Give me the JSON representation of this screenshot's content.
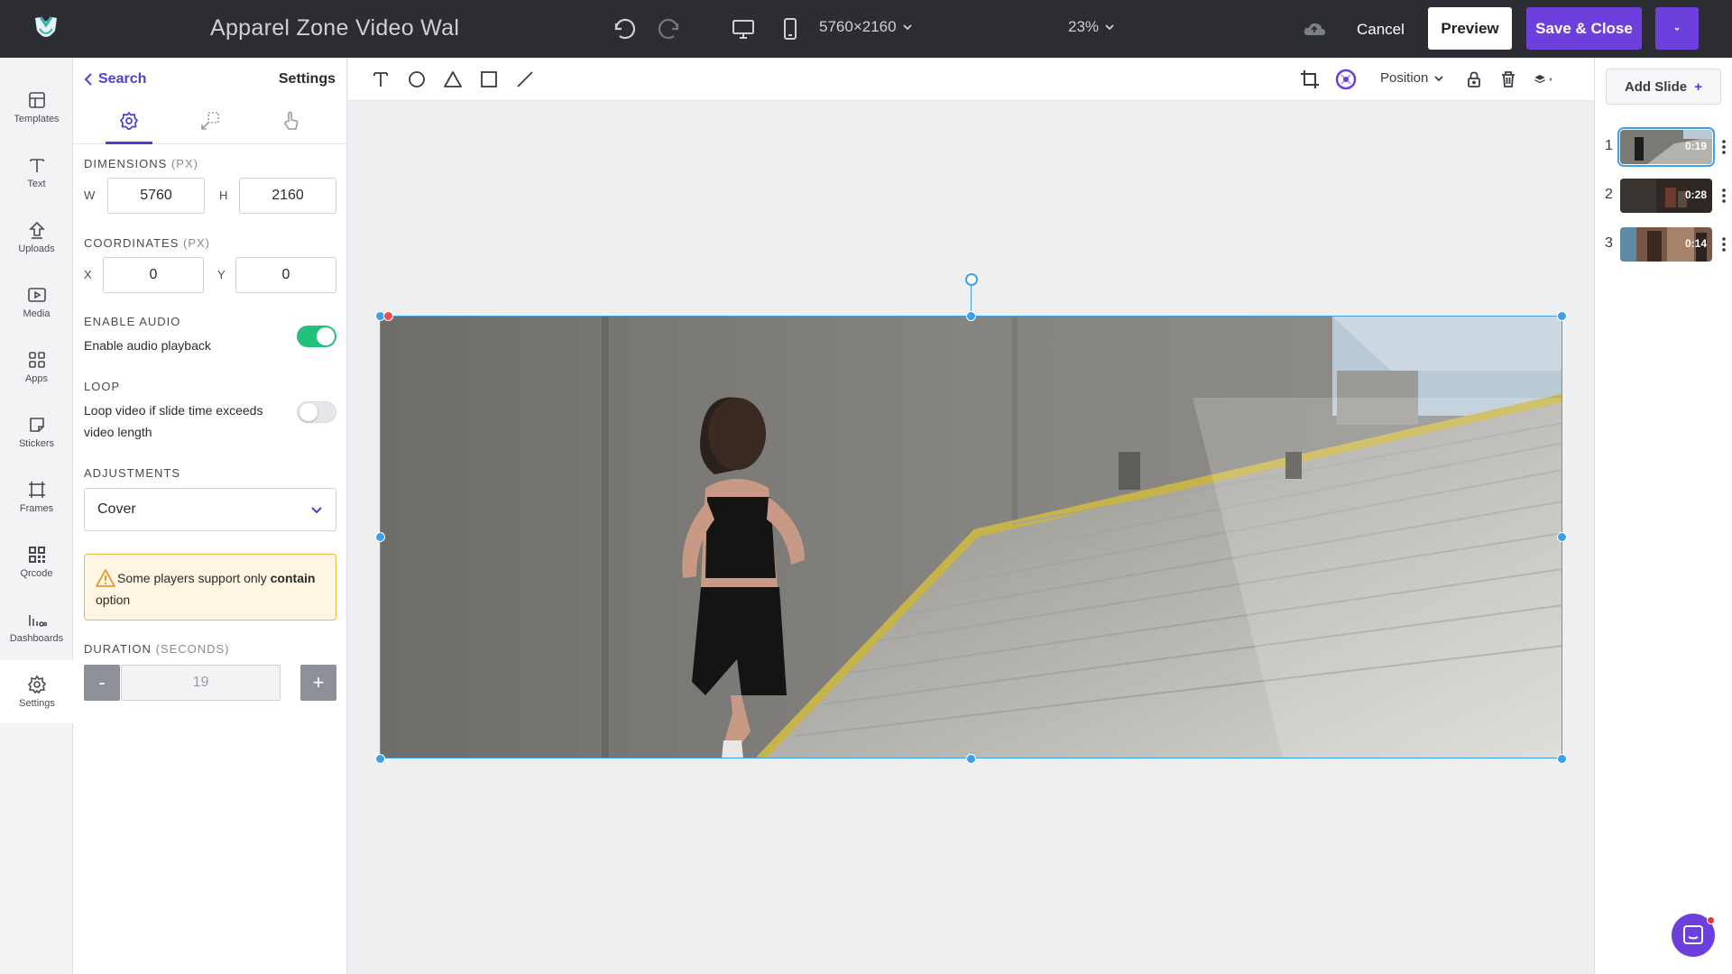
{
  "header": {
    "title": "Apparel Zone Video Wal",
    "resolution": "5760×2160",
    "zoom": "23%",
    "cancel_label": "Cancel",
    "preview_label": "Preview",
    "save_close_label": "Save & Close"
  },
  "nav": {
    "items": [
      {
        "label": "Templates",
        "icon": "templates-icon"
      },
      {
        "label": "Text",
        "icon": "text-icon"
      },
      {
        "label": "Uploads",
        "icon": "uploads-icon"
      },
      {
        "label": "Media",
        "icon": "media-icon"
      },
      {
        "label": "Apps",
        "icon": "apps-icon"
      },
      {
        "label": "Stickers",
        "icon": "stickers-icon"
      },
      {
        "label": "Frames",
        "icon": "frames-icon"
      },
      {
        "label": "Qrcode",
        "icon": "qrcode-icon"
      },
      {
        "label": "Dashboards",
        "icon": "dashboards-icon"
      },
      {
        "label": "Settings",
        "icon": "settings-icon"
      }
    ],
    "active": "Settings"
  },
  "settings": {
    "back_label": "Search",
    "title": "Settings",
    "dimensions": {
      "label": "Dimensions",
      "unit": "(PX)",
      "w_label": "W",
      "w": "5760",
      "h_label": "H",
      "h": "2160"
    },
    "coordinates": {
      "label": "Coordinates",
      "unit": "(PX)",
      "x_label": "X",
      "x": "0",
      "y_label": "Y",
      "y": "0"
    },
    "audio": {
      "label": "Enable Audio",
      "text": "Enable audio playback",
      "enabled": true
    },
    "loop": {
      "label": "Loop",
      "text_line1": "Loop video if slide time exceeds",
      "text_line2": "video length",
      "enabled": false
    },
    "adjustments": {
      "label": "Adjustments",
      "value": "Cover"
    },
    "warning": {
      "prefix": "Some players support only ",
      "bold": "contain",
      "suffix": " option"
    },
    "duration": {
      "label": "Duration",
      "unit": "(SECONDS)",
      "value": "19",
      "minus": "-",
      "plus": "+"
    }
  },
  "canvas_toolbar": {
    "position_label": "Position"
  },
  "slides": {
    "add_label": "Add Slide",
    "add_icon": "+",
    "items": [
      {
        "number": "1",
        "time": "0:19",
        "active": true
      },
      {
        "number": "2",
        "time": "0:28",
        "active": false
      },
      {
        "number": "3",
        "time": "0:14",
        "active": false
      }
    ]
  },
  "colors": {
    "accent": "#6d3fdc",
    "selection": "#3da0e8",
    "toggle_on": "#22c07a",
    "topbar": "#2b2d33"
  }
}
